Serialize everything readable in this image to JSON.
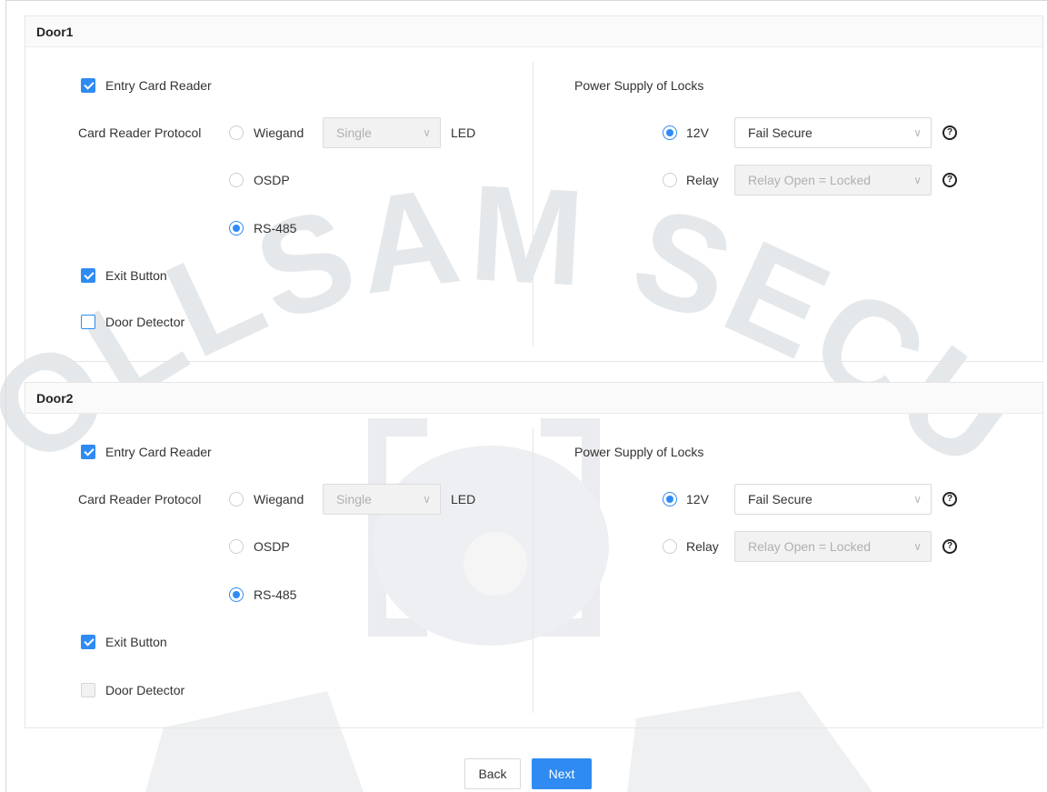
{
  "watermark": {
    "text": "OLLSAM SECURITY"
  },
  "doors": [
    {
      "title": "Door1",
      "entry_card_reader": {
        "label": "Entry Card Reader",
        "checked": true
      },
      "protocol_label": "Card Reader Protocol",
      "protocols": [
        {
          "label": "Wiegand",
          "selected": false
        },
        {
          "label": "OSDP",
          "selected": false
        },
        {
          "label": "RS-485",
          "selected": true
        }
      ],
      "wiegand_select": {
        "value": "Single",
        "disabled": true
      },
      "led_label": "LED",
      "exit_button": {
        "label": "Exit Button",
        "checked": true
      },
      "door_detector": {
        "label": "Door Detector",
        "checked": false
      },
      "power_supply_label": "Power Supply of Locks",
      "power_12v": {
        "label": "12V",
        "selected": true,
        "select_value": "Fail Secure"
      },
      "power_relay": {
        "label": "Relay",
        "selected": false,
        "select_value": "Relay Open = Locked"
      }
    },
    {
      "title": "Door2",
      "entry_card_reader": {
        "label": "Entry Card Reader",
        "checked": true
      },
      "protocol_label": "Card Reader Protocol",
      "protocols": [
        {
          "label": "Wiegand",
          "selected": false
        },
        {
          "label": "OSDP",
          "selected": false
        },
        {
          "label": "RS-485",
          "selected": true
        }
      ],
      "wiegand_select": {
        "value": "Single",
        "disabled": true
      },
      "led_label": "LED",
      "exit_button": {
        "label": "Exit Button",
        "checked": true
      },
      "door_detector": {
        "label": "Door Detector",
        "checked": false,
        "disabled": true
      },
      "power_supply_label": "Power Supply of Locks",
      "power_12v": {
        "label": "12V",
        "selected": true,
        "select_value": "Fail Secure"
      },
      "power_relay": {
        "label": "Relay",
        "selected": false,
        "select_value": "Relay Open = Locked"
      }
    }
  ],
  "footer": {
    "back_label": "Back",
    "next_label": "Next"
  },
  "colors": {
    "accent": "#2f8bf2",
    "border": "#e6e6e6",
    "watermark": "#dfe3e8"
  }
}
